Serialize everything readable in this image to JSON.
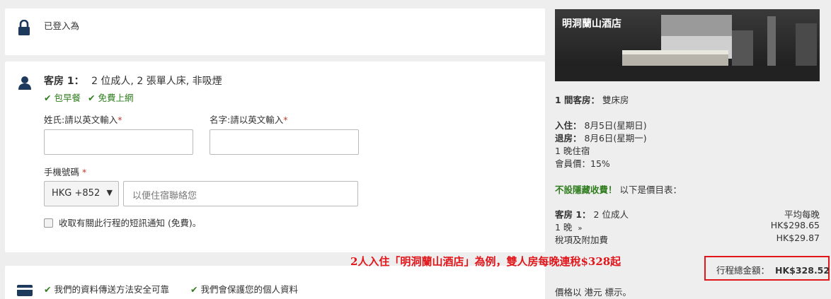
{
  "login": {
    "text": "已登入為"
  },
  "room": {
    "title": "客房 1：",
    "desc": "2 位成人, 2 張單人床, 非吸煙",
    "amenities": [
      "包早餐",
      "免費上網"
    ],
    "surname_label": "姓氏:請以英文輸入",
    "givenname_label": "名字:請以英文輸入",
    "required_mark": "*",
    "phone_label": "手機號碼",
    "country_code": "HKG +852",
    "phone_placeholder": "以便住宿聯絡您",
    "sms_label": "收取有關此行程的短訊通知 (免費)。"
  },
  "security": {
    "items": [
      "我們的資料傳送方法安全可靠",
      "我們會保護您的個人資料"
    ]
  },
  "hotel": {
    "name": "明洞蘭山酒店",
    "rooms_label": "1 間客房：",
    "room_type": "雙床房",
    "checkin_label": "入住：",
    "checkin": "8月5日(星期日)",
    "checkout_label": "退房：",
    "checkout": "8月6日(星期一)",
    "nights": "1 晚住宿",
    "member_price": "會員價：15%",
    "no_hidden_bold": "不設隱藏收費！",
    "no_hidden_rest": "以下是價目表：",
    "room1_label": "客房 1：",
    "room1_guests": "2 位成人",
    "avg_label": "平均每晚",
    "nights_link": "1 晚",
    "nights_price": "HK$298.65",
    "tax_link": "稅項及附加費",
    "tax_price": "HK$29.87",
    "total_label": "行程總金額：",
    "total_price": "HK$328.52",
    "currency_note": "價格以 港元 標示。"
  },
  "annotation": "2人入住「明洞蘭山酒店」為例，雙人房每晚連稅$328起",
  "colors": {
    "green": "#2f7d1e",
    "link": "#1f5fa8",
    "annotation": "#e0161b",
    "icon": "#1d3a5c"
  }
}
